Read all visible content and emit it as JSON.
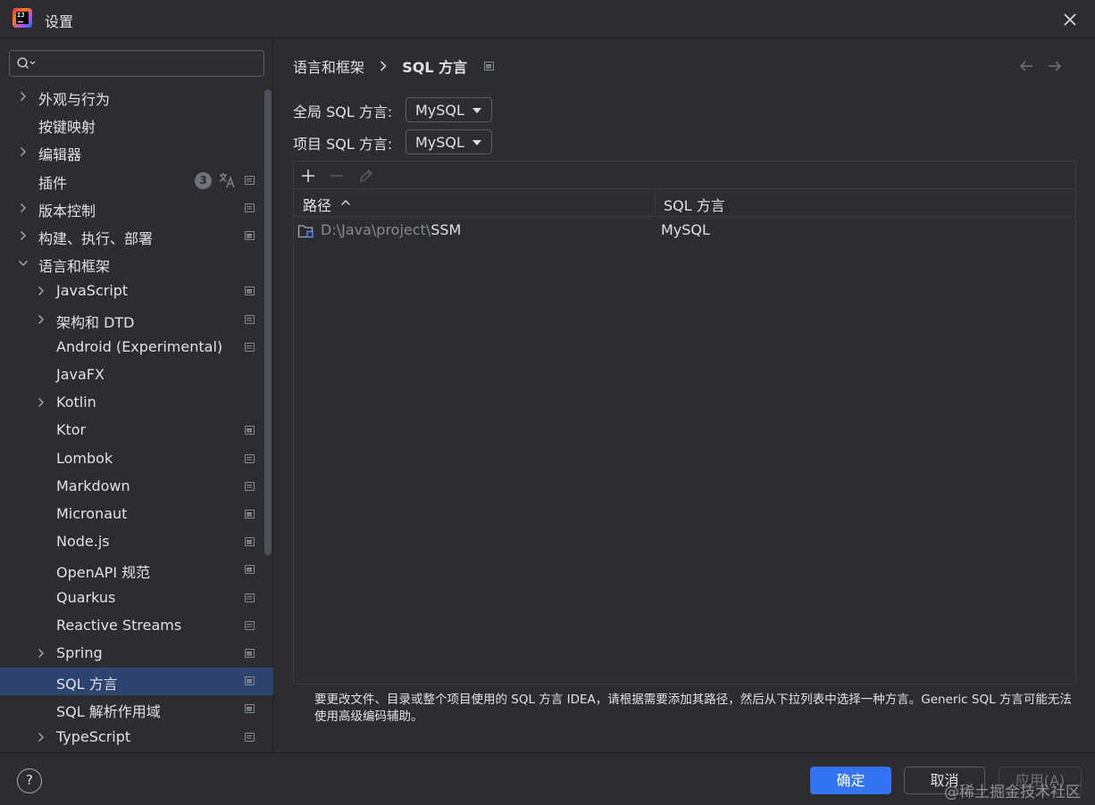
{
  "window": {
    "title": "设置",
    "app_icon_text": "IJ"
  },
  "search": {
    "placeholder": "",
    "value": ""
  },
  "sidebar": {
    "plugins_badge": "3",
    "items": [
      {
        "label": "外观与行为",
        "expandable": true,
        "expanded": false,
        "level": 0
      },
      {
        "label": "按键映射",
        "expandable": false,
        "level": 0
      },
      {
        "label": "编辑器",
        "expandable": true,
        "expanded": false,
        "level": 0
      },
      {
        "label": "插件",
        "expandable": false,
        "level": 0
      },
      {
        "label": "版本控制",
        "expandable": true,
        "expanded": false,
        "level": 0
      },
      {
        "label": "构建、执行、部署",
        "expandable": true,
        "expanded": false,
        "level": 0
      },
      {
        "label": "语言和框架",
        "expandable": true,
        "expanded": true,
        "level": 0
      },
      {
        "label": "JavaScript",
        "expandable": true,
        "expanded": false,
        "level": 1
      },
      {
        "label": "架构和 DTD",
        "expandable": true,
        "expanded": false,
        "level": 1
      },
      {
        "label": "Android (Experimental)",
        "expandable": false,
        "level": 1
      },
      {
        "label": "JavaFX",
        "expandable": false,
        "level": 1
      },
      {
        "label": "Kotlin",
        "expandable": true,
        "expanded": false,
        "level": 1
      },
      {
        "label": "Ktor",
        "expandable": false,
        "level": 1
      },
      {
        "label": "Lombok",
        "expandable": false,
        "level": 1
      },
      {
        "label": "Markdown",
        "expandable": false,
        "level": 1
      },
      {
        "label": "Micronaut",
        "expandable": false,
        "level": 1
      },
      {
        "label": "Node.js",
        "expandable": false,
        "level": 1
      },
      {
        "label": "OpenAPI 规范",
        "expandable": false,
        "level": 1
      },
      {
        "label": "Quarkus",
        "expandable": false,
        "level": 1
      },
      {
        "label": "Reactive Streams",
        "expandable": false,
        "level": 1
      },
      {
        "label": "Spring",
        "expandable": true,
        "expanded": false,
        "level": 1
      },
      {
        "label": "SQL 方言",
        "expandable": false,
        "level": 1,
        "selected": true
      },
      {
        "label": "SQL 解析作用域",
        "expandable": false,
        "level": 1
      },
      {
        "label": "TypeScript",
        "expandable": true,
        "expanded": false,
        "level": 1
      }
    ]
  },
  "breadcrumb": {
    "parent": "语言和框架",
    "current": "SQL 方言"
  },
  "settings": {
    "global_label": "全局 SQL 方言:",
    "global_value": "MySQL",
    "project_label": "项目 SQL 方言:",
    "project_value": "MySQL"
  },
  "table": {
    "columns": [
      "路径",
      "SQL 方言"
    ],
    "rows": [
      {
        "path_prefix": "D:\\Java\\project\\",
        "path_name": "SSM",
        "dialect": "MySQL"
      }
    ]
  },
  "description": "要更改文件、目录或整个项目使用的 SQL 方言 IDEA，请根据需要添加其路径，然后从下拉列表中选择一种方言。Generic SQL 方言可能无法使用高级编码辅助。",
  "footer": {
    "help_label": "?",
    "ok_label": "确定",
    "cancel_label": "取消",
    "apply_label": "应用(A)",
    "watermark": "@稀土掘金技术社区"
  },
  "colors": {
    "background": "#2b2d30",
    "selection": "#2e436e",
    "primary_button": "#3574f0",
    "text": "#dfe1e5",
    "muted_text": "#868a91"
  }
}
